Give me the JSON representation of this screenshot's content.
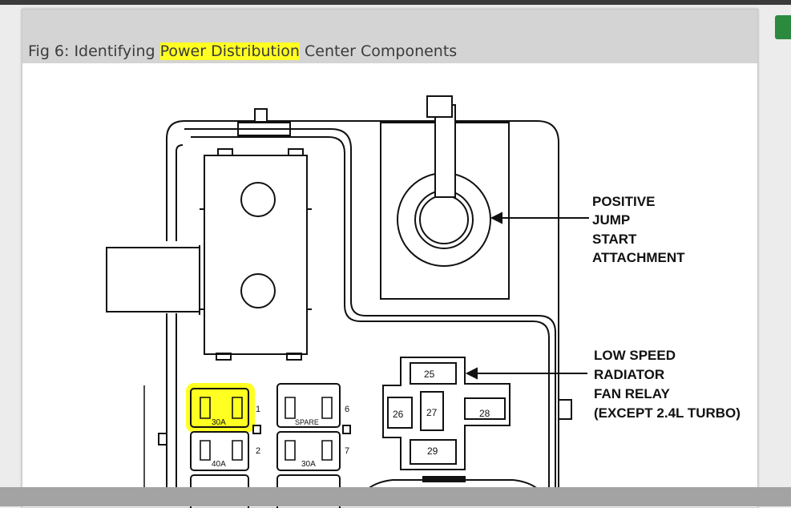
{
  "caption": {
    "prefix": "Fig 6: Identifying ",
    "highlight": "Power Distribution",
    "suffix": " Center Components"
  },
  "callouts": {
    "jump_start": [
      "POSITIVE",
      "JUMP",
      "START",
      "ATTACHMENT"
    ],
    "fan_relay": [
      "LOW SPEED",
      "RADIATOR",
      "FAN RELAY",
      "(EXCEPT 2.4L TURBO)"
    ]
  },
  "fuses": {
    "f1": {
      "rating": "30A",
      "number": "1"
    },
    "f2": {
      "rating": "40A",
      "number": "2"
    },
    "f6": {
      "rating": "SPARE",
      "number": "6"
    },
    "f7": {
      "rating": "30A",
      "number": "7"
    }
  },
  "relays": {
    "r25": "25",
    "r26": "26",
    "r27": "27",
    "r28": "28",
    "r29": "29"
  },
  "colors": {
    "highlight": "#ffff22",
    "caption_bg": "#d4d4d4"
  }
}
